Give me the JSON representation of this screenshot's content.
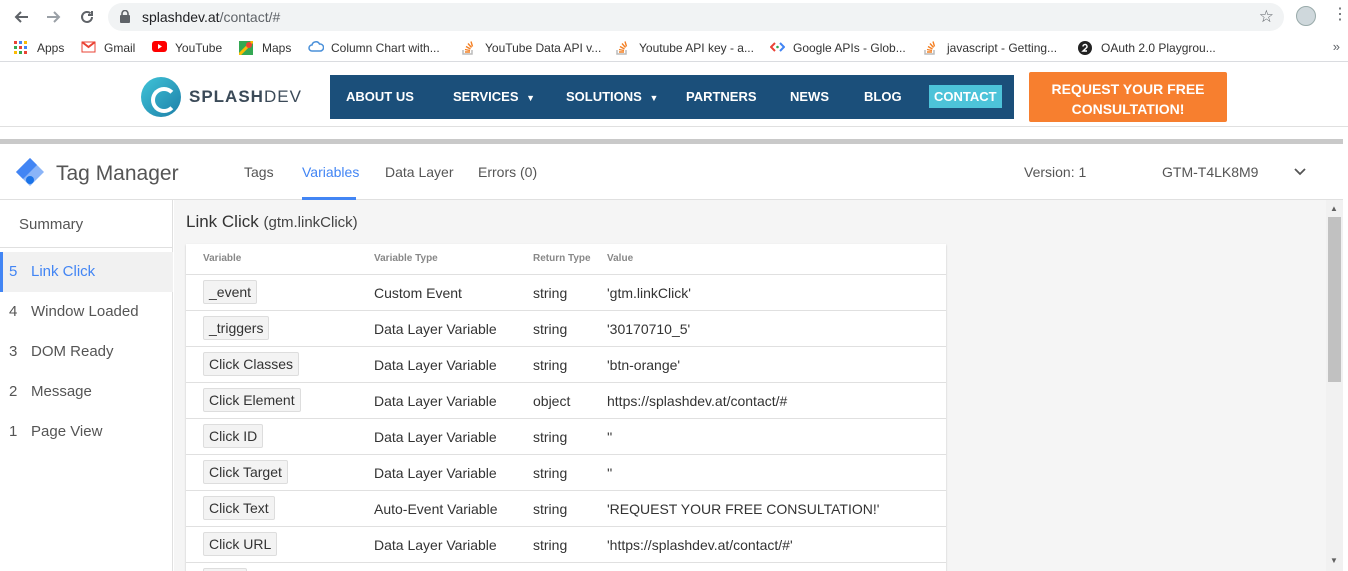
{
  "browser": {
    "url_host": "splashdev.at",
    "url_path": "/contact/#"
  },
  "bookmarks": [
    {
      "label": "Apps",
      "icon": "apps-grid-icon"
    },
    {
      "label": "Gmail",
      "icon": "gmail-icon"
    },
    {
      "label": "YouTube",
      "icon": "youtube-icon"
    },
    {
      "label": "Maps",
      "icon": "maps-icon"
    },
    {
      "label": "Column Chart with...",
      "icon": "cloud-icon"
    },
    {
      "label": "YouTube Data API v...",
      "icon": "stackoverflow-icon"
    },
    {
      "label": "Youtube API key - a...",
      "icon": "stackoverflow-icon"
    },
    {
      "label": "Google APIs - Glob...",
      "icon": "google-apis-icon"
    },
    {
      "label": "javascript - Getting...",
      "icon": "stackoverflow-icon"
    },
    {
      "label": "OAuth 2.0 Playgrou...",
      "icon": "oauth-icon"
    }
  ],
  "site": {
    "logo_text_bold": "SPLASH",
    "logo_text_light": "DEV",
    "nav": [
      "ABOUT US",
      "SERVICES",
      "SOLUTIONS",
      "PARTNERS",
      "NEWS",
      "BLOG",
      "CONTACT"
    ],
    "cta_line1": "REQUEST YOUR FREE",
    "cta_line2": "CONSULTATION!",
    "colors": {
      "nav_bg": "#1b4f7a",
      "contact_bg": "#4dc3d9",
      "cta_bg": "#f77f2f"
    }
  },
  "tag_manager": {
    "title": "Tag Manager",
    "tabs": [
      "Tags",
      "Variables",
      "Data Layer",
      "Errors (0)"
    ],
    "active_tab": "Variables",
    "version": "Version: 1",
    "container_id": "GTM-T4LK8M9"
  },
  "sidebar": {
    "summary": "Summary",
    "events": [
      {
        "num": "5",
        "label": "Link Click",
        "active": true
      },
      {
        "num": "4",
        "label": "Window Loaded"
      },
      {
        "num": "3",
        "label": "DOM Ready"
      },
      {
        "num": "2",
        "label": "Message"
      },
      {
        "num": "1",
        "label": "Page View"
      }
    ]
  },
  "event": {
    "title": "Link Click",
    "subtitle": "(gtm.linkClick)"
  },
  "variables_table": {
    "headers": [
      "Variable",
      "Variable Type",
      "Return Type",
      "Value"
    ],
    "rows": [
      {
        "variable": "_event",
        "type": "Custom Event",
        "return": "string",
        "value": "'gtm.linkClick'"
      },
      {
        "variable": "_triggers",
        "type": "Data Layer Variable",
        "return": "string",
        "value": "'30170710_5'"
      },
      {
        "variable": "Click Classes",
        "type": "Data Layer Variable",
        "return": "string",
        "value": "'btn-orange'"
      },
      {
        "variable": "Click Element",
        "type": "Data Layer Variable",
        "return": "object",
        "value": "https://splashdev.at/contact/#"
      },
      {
        "variable": "Click ID",
        "type": "Data Layer Variable",
        "return": "string",
        "value": "''"
      },
      {
        "variable": "Click Target",
        "type": "Data Layer Variable",
        "return": "string",
        "value": "''"
      },
      {
        "variable": "Click Text",
        "type": "Auto-Event Variable",
        "return": "string",
        "value": "'REQUEST YOUR FREE CONSULTATION!'"
      },
      {
        "variable": "Click URL",
        "type": "Data Layer Variable",
        "return": "string",
        "value": "'https://splashdev.at/contact/#'"
      }
    ]
  }
}
